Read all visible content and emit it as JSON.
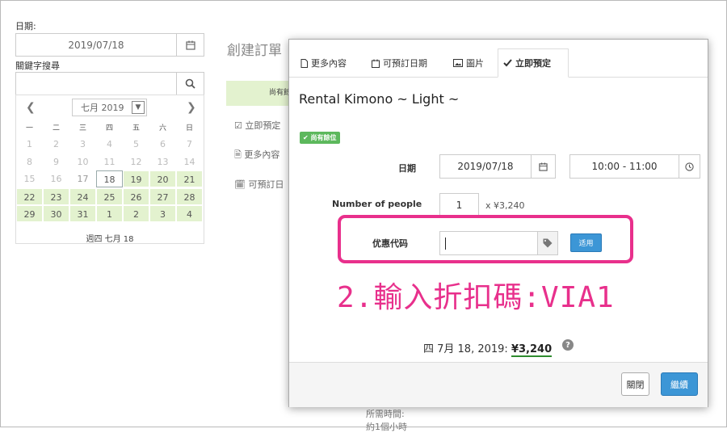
{
  "left": {
    "date_label": "日期:",
    "date_value": "2019/07/18",
    "keyword_label": "關鍵字搜尋",
    "keyword_value": "",
    "calendar": {
      "month_select": "七月 2019",
      "weekdays": [
        "一",
        "二",
        "三",
        "四",
        "五",
        "六",
        "日"
      ],
      "rows": [
        [
          {
            "d": "1",
            "s": "off"
          },
          {
            "d": "2",
            "s": "off"
          },
          {
            "d": "3",
            "s": "off"
          },
          {
            "d": "4",
            "s": "off"
          },
          {
            "d": "5",
            "s": "off"
          },
          {
            "d": "6",
            "s": "off"
          },
          {
            "d": "7",
            "s": "off"
          }
        ],
        [
          {
            "d": "8",
            "s": "off"
          },
          {
            "d": "9",
            "s": "off"
          },
          {
            "d": "10",
            "s": "off"
          },
          {
            "d": "11",
            "s": "off"
          },
          {
            "d": "12",
            "s": "off"
          },
          {
            "d": "13",
            "s": "off"
          },
          {
            "d": "14",
            "s": "off"
          }
        ],
        [
          {
            "d": "15",
            "s": "off"
          },
          {
            "d": "16",
            "s": "off"
          },
          {
            "d": "17",
            "s": "dim"
          },
          {
            "d": "18",
            "s": "sel"
          },
          {
            "d": "19",
            "s": "av"
          },
          {
            "d": "20",
            "s": "av"
          },
          {
            "d": "21",
            "s": "av"
          }
        ],
        [
          {
            "d": "22",
            "s": "av"
          },
          {
            "d": "23",
            "s": "av"
          },
          {
            "d": "24",
            "s": "av"
          },
          {
            "d": "25",
            "s": "av"
          },
          {
            "d": "26",
            "s": "av"
          },
          {
            "d": "27",
            "s": "av"
          },
          {
            "d": "28",
            "s": "av"
          }
        ],
        [
          {
            "d": "29",
            "s": "av"
          },
          {
            "d": "30",
            "s": "av"
          },
          {
            "d": "31",
            "s": "av"
          },
          {
            "d": "1",
            "s": "av"
          },
          {
            "d": "2",
            "s": "av"
          },
          {
            "d": "3",
            "s": "av"
          },
          {
            "d": "4",
            "s": "av"
          }
        ]
      ],
      "footer": "週四 七月 18"
    }
  },
  "background": {
    "title": "創建訂單",
    "green_text": "尚有餘",
    "items": [
      "立即預定",
      "更多內容",
      "可預訂日"
    ],
    "footer_text": "所需時間:",
    "footer_text2": "約1個小時"
  },
  "modal": {
    "tabs": [
      {
        "label": "更多內容",
        "icon": "file-icon"
      },
      {
        "label": "可預訂日期",
        "icon": "calendar-icon"
      },
      {
        "label": "圖片",
        "icon": "image-icon"
      },
      {
        "label": "立即預定",
        "icon": "check-icon",
        "active": true
      }
    ],
    "title": "Rental Kimono ~ Light ~",
    "badge": "尚有餘位",
    "date_label": "日期",
    "date_value": "2019/07/18",
    "time_value": "10:00 - 11:00",
    "people_label": "Number of people",
    "people_value": "1",
    "price_text": "x ¥3,240",
    "coupon_label": "优惠代码",
    "coupon_value": "",
    "apply_label": "适用",
    "annotation": "2.輸入折扣碼:VIA1",
    "summary_prefix": "四 7月 18, 2019:",
    "summary_price": "¥3,240",
    "close_label": "關閉",
    "continue_label": "繼續"
  },
  "colors": {
    "accent": "#3c96d6",
    "available": "#e3f2cf",
    "annotation": "#e8308c",
    "badge": "#5cb85c"
  }
}
